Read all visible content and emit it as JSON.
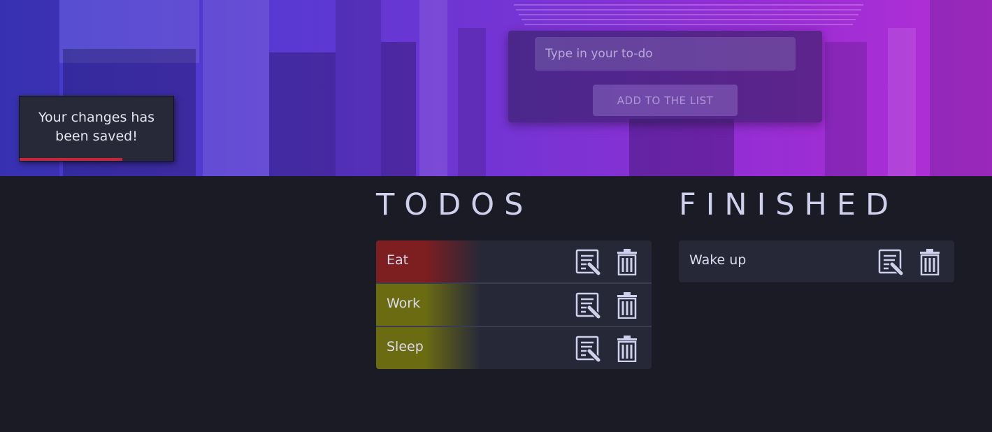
{
  "form": {
    "input_placeholder": "Type in your to-do",
    "input_value": "",
    "add_button_label": "ADD TO THE LIST"
  },
  "toast": {
    "message": "Your changes has been saved!",
    "progress_fraction": 0.67
  },
  "todos": {
    "heading": "TODOS",
    "items": [
      {
        "label": "Eat",
        "priority_color": "#7d1e20"
      },
      {
        "label": "Work",
        "priority_color": "#6b6c12"
      },
      {
        "label": "Sleep",
        "priority_color": "#6b6c12"
      }
    ]
  },
  "finished": {
    "heading": "FINISHED",
    "items": [
      {
        "label": "Wake up"
      }
    ]
  },
  "icons": {
    "edit": "edit-icon",
    "delete": "trash-icon"
  },
  "colors": {
    "background": "#1a1b24",
    "item_background": "#262838",
    "heading": "#cfd0ec",
    "toast_progress": "#c4293a",
    "hero_gradient_start": "#3f3acb",
    "hero_gradient_end": "#b72fd6"
  }
}
